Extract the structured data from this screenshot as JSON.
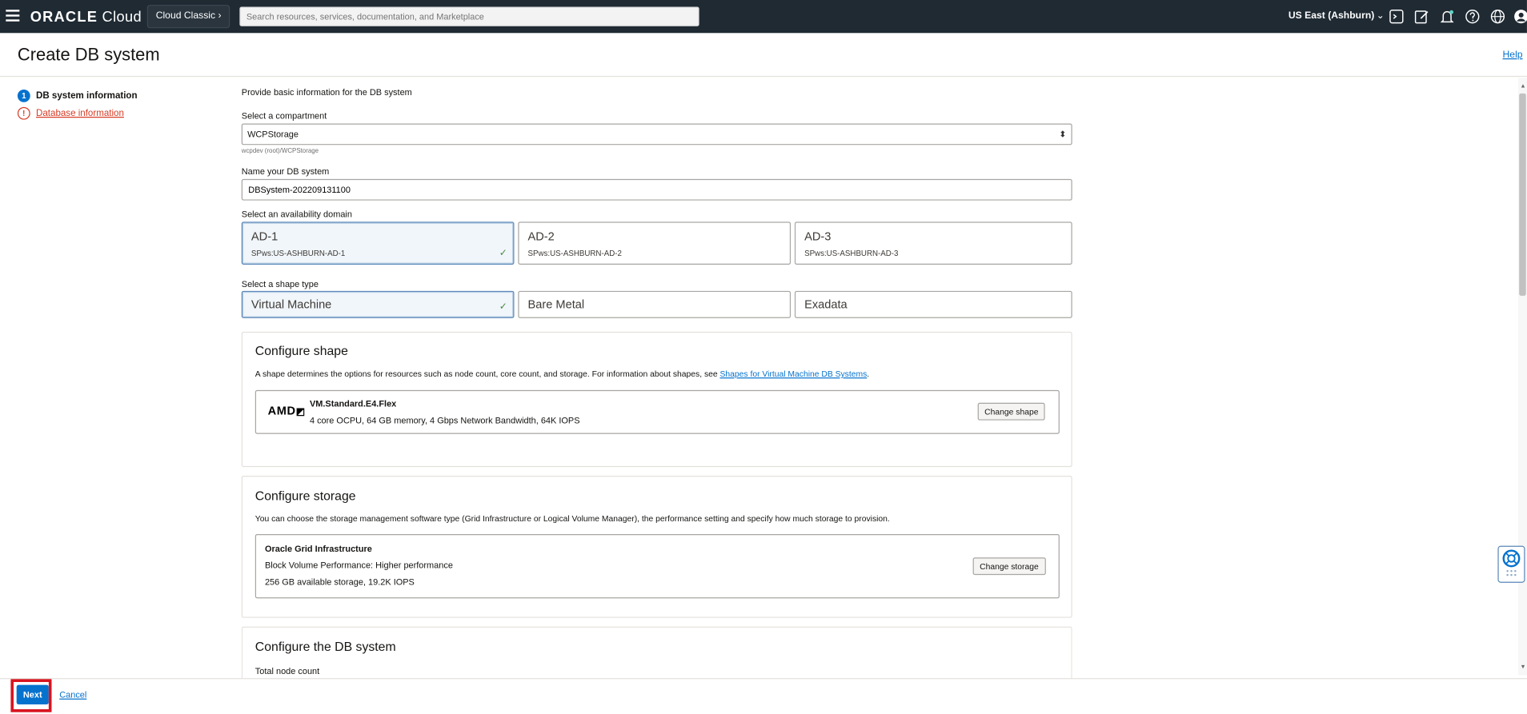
{
  "topbar": {
    "logo_brand": "ORACLE",
    "logo_product": " Cloud",
    "cloud_classic": "Cloud Classic",
    "cloud_classic_chevron": "›",
    "search_placeholder": "Search resources, services, documentation, and Marketplace",
    "region": "US East (Ashburn)",
    "region_chevron": "⌄",
    "icons": [
      "hamburger-icon",
      "cloud-shell-icon",
      "edit-icon",
      "bell-icon",
      "help-circle-icon",
      "globe-icon",
      "user-icon"
    ]
  },
  "page": {
    "title": "Create DB system",
    "help_link": "Help"
  },
  "steps": [
    {
      "num": "1",
      "label": "DB system information",
      "state": "active"
    },
    {
      "num": "!",
      "label": "Database information",
      "state": "error"
    }
  ],
  "form": {
    "intro": "Provide basic information for the DB system",
    "compartment": {
      "label": "Select a compartment",
      "value": "WCPStorage",
      "path": "wcpdev (root)/WCPStorage"
    },
    "name": {
      "label": "Name your DB system",
      "value": "DBSystem-202209131100"
    },
    "availability_domain": {
      "label": "Select an availability domain",
      "options": [
        {
          "title": "AD-1",
          "sub": "SPws:US-ASHBURN-AD-1",
          "selected": true
        },
        {
          "title": "AD-2",
          "sub": "SPws:US-ASHBURN-AD-2",
          "selected": false
        },
        {
          "title": "AD-3",
          "sub": "SPws:US-ASHBURN-AD-3",
          "selected": false
        }
      ]
    },
    "shape_type": {
      "label": "Select a shape type",
      "options": [
        {
          "title": "Virtual Machine",
          "selected": true
        },
        {
          "title": "Bare Metal",
          "selected": false
        },
        {
          "title": "Exadata",
          "selected": false
        }
      ]
    },
    "configure_shape": {
      "title": "Configure shape",
      "desc": "A shape determines the options for resources such as node count, core count, and storage. For information about shapes, see ",
      "desc_link": "Shapes for Virtual Machine DB Systems",
      "desc_end": ".",
      "vendor_logo": "AMD",
      "shape_name": "VM.Standard.E4.Flex",
      "shape_detail": "4 core OCPU, 64 GB memory, 4 Gbps Network Bandwidth, 64K IOPS",
      "change_button": "Change shape"
    },
    "configure_storage": {
      "title": "Configure storage",
      "desc": "You can choose the storage management software type (Grid Infrastructure or Logical Volume Manager), the performance setting and specify how much storage to provision.",
      "software": "Oracle Grid Infrastructure",
      "performance": "Block Volume Performance: Higher performance",
      "capacity": "256 GB available storage, 19.2K IOPS",
      "change_button": "Change storage"
    },
    "configure_db": {
      "title": "Configure the DB system",
      "node_count_label": "Total node count"
    }
  },
  "footer": {
    "next": "Next",
    "cancel": "Cancel"
  },
  "colors": {
    "topbar_bg": "#1f2a33",
    "accent_blue": "#0572ce",
    "error_red": "#d63b25",
    "highlight_red": "#d8141f",
    "check_green": "#4b8a3f"
  }
}
